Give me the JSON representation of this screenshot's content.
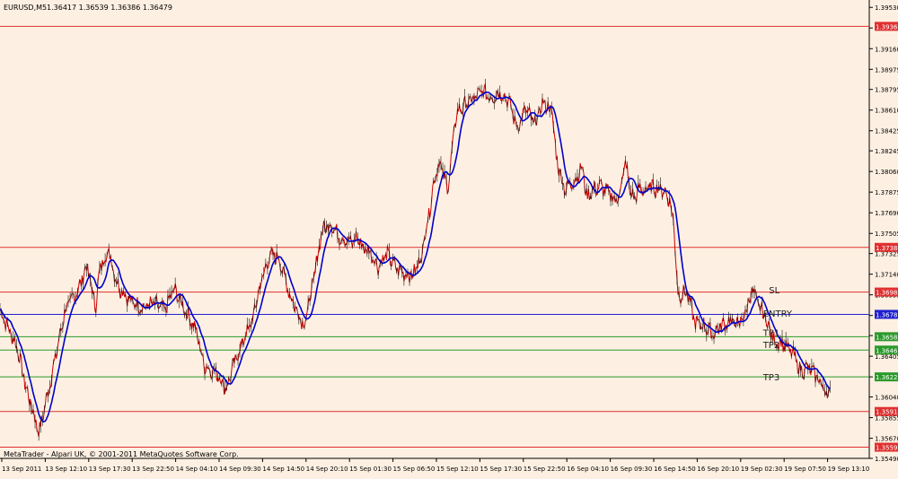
{
  "header": {
    "symbol": "EURUSD,M5",
    "ohlc": "1.36417 1.36539 1.36386 1.36479"
  },
  "footer": {
    "credit": "MetaTrader - Alpari UK, © 2001-2011 MetaQuotes Software Corp."
  },
  "colors": {
    "background": "#fdf0e2",
    "price_line": "#cc0000",
    "moving_average": "#0000cc",
    "red_level": "#e03030",
    "blue_level": "#2020d0",
    "green_level": "#2a9a2a"
  },
  "chart_data": {
    "type": "line",
    "ylim": [
      1.3549,
      1.3958
    ],
    "y_ticks": [
      "1.39530",
      "1.39345",
      "1.39160",
      "1.38975",
      "1.38795",
      "1.38610",
      "1.38425",
      "1.38245",
      "1.38060",
      "1.37875",
      "1.37690",
      "1.37505",
      "1.37325",
      "1.37140",
      "1.36955",
      "1.36770",
      "1.36590",
      "1.36405",
      "1.36220",
      "1.36040",
      "1.35855",
      "1.35670",
      "1.35490"
    ],
    "x_ticks": [
      "13 Sep 2011",
      "13 Sep 12:10",
      "13 Sep 17:30",
      "13 Sep 22:50",
      "14 Sep 04:10",
      "14 Sep 09:30",
      "14 Sep 14:50",
      "14 Sep 20:10",
      "15 Sep 01:30",
      "15 Sep 06:50",
      "15 Sep 12:10",
      "15 Sep 17:30",
      "15 Sep 22:50",
      "16 Sep 04:10",
      "16 Sep 09:30",
      "16 Sep 14:50",
      "16 Sep 20:10",
      "19 Sep 02:30",
      "19 Sep 07:50",
      "19 Sep 13:10"
    ],
    "price_levels": [
      {
        "value": 1.3936,
        "label": "1.39360",
        "color": "red"
      },
      {
        "value": 1.3738,
        "label": "1.37380",
        "color": "red"
      },
      {
        "value": 1.3698,
        "label": "1.36980",
        "color": "red"
      },
      {
        "value": 1.3678,
        "label": "1.36780",
        "color": "blue"
      },
      {
        "value": 1.3658,
        "label": "1.36580",
        "color": "green"
      },
      {
        "value": 1.3646,
        "label": "1.36460",
        "color": "green"
      },
      {
        "value": 1.3622,
        "label": "1.36227",
        "color": "green"
      },
      {
        "value": 1.3591,
        "label": "1.35910",
        "color": "red"
      },
      {
        "value": 1.3559,
        "label": "1.35590",
        "color": "red"
      }
    ],
    "annotations": [
      {
        "text": "SL",
        "x": 0.8846,
        "y": 1.37
      },
      {
        "text": "ENTRY",
        "x": 0.8778,
        "y": 1.3679
      },
      {
        "text": "TP1",
        "x": 0.8778,
        "y": 1.3662
      },
      {
        "text": "TP2",
        "x": 0.8778,
        "y": 1.3651
      },
      {
        "text": "TP3",
        "x": 0.8778,
        "y": 1.3622
      }
    ],
    "series": [
      {
        "name": "",
        "x": [
          0,
          0.02,
          0.03,
          0.045,
          0.06,
          0.075,
          0.09,
          0.1,
          0.11,
          0.115,
          0.125,
          0.135,
          0.15,
          0.165,
          0.175,
          0.19,
          0.2,
          0.21,
          0.225,
          0.235,
          0.25,
          0.26,
          0.27,
          0.28,
          0.29,
          0.3,
          0.31,
          0.32,
          0.335,
          0.35,
          0.36,
          0.37,
          0.38,
          0.39,
          0.405,
          0.41,
          0.42,
          0.425,
          0.435,
          0.445,
          0.455,
          0.465,
          0.475,
          0.485,
          0.49,
          0.495,
          0.5,
          0.505,
          0.51,
          0.515,
          0.525,
          0.535,
          0.545,
          0.555,
          0.565,
          0.575,
          0.585,
          0.595,
          0.605,
          0.615,
          0.625,
          0.635,
          0.64,
          0.645,
          0.65,
          0.66,
          0.67,
          0.675,
          0.68,
          0.69,
          0.7,
          0.71,
          0.715,
          0.72,
          0.725,
          0.73,
          0.735,
          0.74,
          0.75,
          0.76,
          0.765,
          0.77,
          0.775,
          0.78,
          0.79,
          0.8,
          0.81,
          0.82,
          0.83,
          0.84,
          0.85,
          0.855,
          0.86,
          0.865,
          0.87,
          0.88,
          0.89,
          0.9,
          0.905,
          0.91,
          0.915,
          0.92,
          0.93,
          0.94,
          0.95,
          0.96,
          0.965,
          0.97,
          0.975,
          0.98,
          0.99,
          1.0
        ],
        "values": [
          1.3682,
          1.3648,
          1.3612,
          1.3572,
          1.3625,
          1.3682,
          1.37,
          1.3722,
          1.3684,
          1.372,
          1.3735,
          1.3705,
          1.369,
          1.3684,
          1.3688,
          1.3682,
          1.3701,
          1.3686,
          1.3665,
          1.3632,
          1.3625,
          1.3611,
          1.3635,
          1.3655,
          1.3672,
          1.3706,
          1.373,
          1.373,
          1.3692,
          1.3668,
          1.3705,
          1.3752,
          1.376,
          1.3748,
          1.3742,
          1.3747,
          1.3736,
          1.3735,
          1.3721,
          1.3732,
          1.372,
          1.3715,
          1.3713,
          1.373,
          1.3755,
          1.3775,
          1.3801,
          1.3814,
          1.3804,
          1.379,
          1.3858,
          1.3866,
          1.3871,
          1.3878,
          1.3872,
          1.3877,
          1.387,
          1.3845,
          1.3862,
          1.3848,
          1.3868,
          1.386,
          1.3819,
          1.3802,
          1.379,
          1.3797,
          1.381,
          1.3783,
          1.3788,
          1.3793,
          1.3787,
          1.3779,
          1.3796,
          1.3814,
          1.3787,
          1.3782,
          1.379,
          1.3789,
          1.3792,
          1.379,
          1.3788,
          1.3781,
          1.376,
          1.3695,
          1.3698,
          1.367,
          1.3668,
          1.366,
          1.3668,
          1.3672,
          1.3669,
          1.3675,
          1.3685,
          1.3701,
          1.369,
          1.3676,
          1.3655,
          1.3652,
          1.3648,
          1.3645,
          1.3638,
          1.3628,
          1.363,
          1.3622,
          1.3608,
          1.361,
          1.3612,
          1.3633,
          1.3655,
          1.3642,
          1.3628,
          1.3635
        ]
      }
    ]
  }
}
